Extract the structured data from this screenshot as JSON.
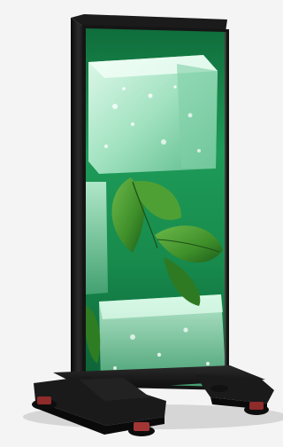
{
  "image": {
    "subject": "",
    "background_color": "#f4f4f4"
  },
  "colors": {
    "frame": "#141414",
    "frame_edge": "#2a2a2a",
    "screen_green_dark": "#0b5a32",
    "screen_green_mid": "#1f9a5a",
    "screen_green_light": "#46c07e",
    "ice_highlight": "#e8fff2",
    "ice_body": "#9fe0bf",
    "leaf_dark": "#1c5e1a",
    "leaf_mid": "#3f8f2a",
    "leaf_light": "#6cb84a",
    "base": "#1a1a1a",
    "foot_accent": "#b23a3a"
  },
  "icons": [
    "display-stand-icon"
  ]
}
